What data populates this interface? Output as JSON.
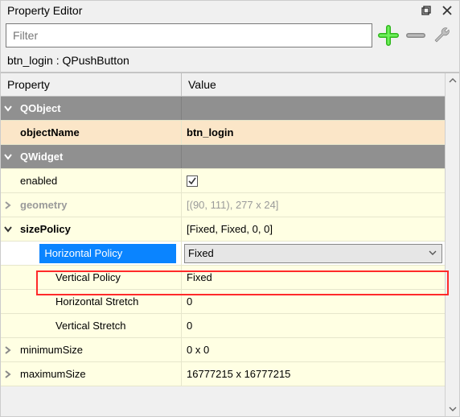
{
  "window": {
    "title": "Property Editor"
  },
  "toolbar": {
    "filter_placeholder": "Filter"
  },
  "object_line": "btn_login : QPushButton",
  "headers": {
    "property": "Property",
    "value": "Value"
  },
  "groups": {
    "qobject": "QObject",
    "qwidget": "QWidget"
  },
  "props": {
    "objectName": {
      "label": "objectName",
      "value": "btn_login"
    },
    "enabled": {
      "label": "enabled",
      "checked": true
    },
    "geometry": {
      "label": "geometry",
      "value": "[(90, 111), 277 x 24]"
    },
    "sizePolicy": {
      "label": "sizePolicy",
      "summary": "[Fixed, Fixed, 0, 0]",
      "horizontalPolicy": {
        "label": "Horizontal Policy",
        "value": "Fixed"
      },
      "verticalPolicy": {
        "label": "Vertical Policy",
        "value": "Fixed"
      },
      "horizontalStretch": {
        "label": "Horizontal Stretch",
        "value": "0"
      },
      "verticalStretch": {
        "label": "Vertical Stretch",
        "value": "0"
      }
    },
    "minimumSize": {
      "label": "minimumSize",
      "value": "0 x 0"
    },
    "maximumSize": {
      "label": "maximumSize",
      "value": "16777215 x 16777215"
    }
  }
}
